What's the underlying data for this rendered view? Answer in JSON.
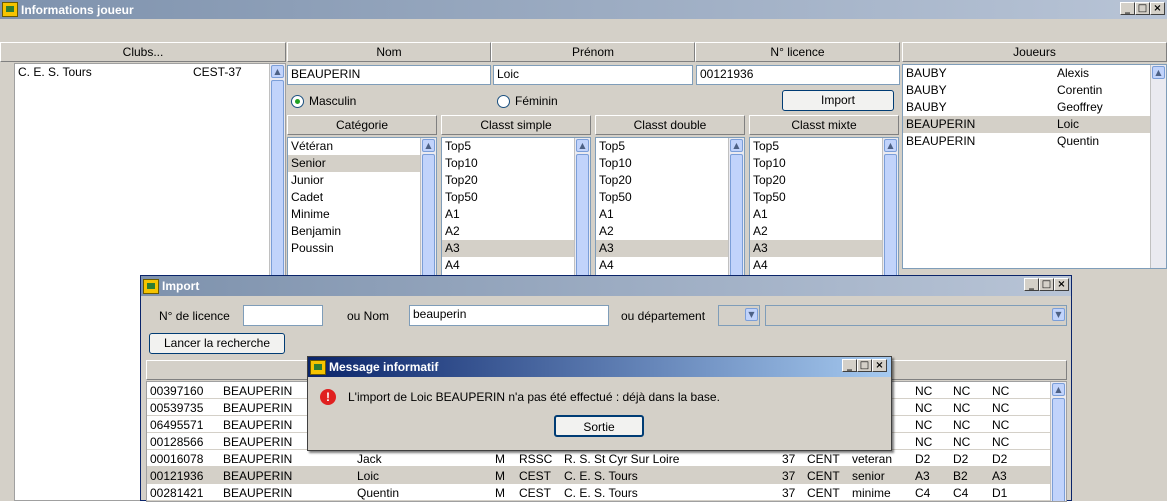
{
  "main_window": {
    "title": "Informations joueur",
    "clubs_button": "Clubs...",
    "headers": {
      "nom": "Nom",
      "prenom": "Prénom",
      "licence": "N° licence",
      "joueurs": "Joueurs"
    },
    "club_row": {
      "name": "C. E. S. Tours",
      "code": "CEST-37"
    },
    "player": {
      "nom": "BEAUPERIN",
      "prenom": "Loic",
      "licence": "00121936"
    },
    "gender": {
      "masculin": "Masculin",
      "feminin": "Féminin",
      "selected": "Masculin"
    },
    "import_button": "Import",
    "columns": {
      "categorie": "Catégorie",
      "simple": "Classt simple",
      "double": "Classt double",
      "mixte": "Classt mixte"
    },
    "categories": [
      {
        "label": "Vétéran",
        "selected": false
      },
      {
        "label": "Senior",
        "selected": true
      },
      {
        "label": "Junior",
        "selected": false
      },
      {
        "label": "Cadet",
        "selected": false
      },
      {
        "label": "Minime",
        "selected": false
      },
      {
        "label": "Benjamin",
        "selected": false
      },
      {
        "label": "Poussin",
        "selected": false
      }
    ],
    "classements": [
      "Top5",
      "Top10",
      "Top20",
      "Top50",
      "A1",
      "A2",
      "A3",
      "A4"
    ],
    "classement_selected": "A3",
    "joueurs": [
      {
        "nom": "BAUBY",
        "prenom": "Alexis",
        "selected": false
      },
      {
        "nom": "BAUBY",
        "prenom": "Corentin",
        "selected": false
      },
      {
        "nom": "BAUBY",
        "prenom": "Geoffrey",
        "selected": false
      },
      {
        "nom": "BEAUPERIN",
        "prenom": "Loic",
        "selected": true
      },
      {
        "nom": "BEAUPERIN",
        "prenom": "Quentin",
        "selected": false
      }
    ]
  },
  "import_window": {
    "title": "Import",
    "licence_label": "N° de licence",
    "licence_value": "",
    "nom_label": "ou Nom",
    "nom_value": "beauperin",
    "dept_label": "ou département",
    "search_button": "Lancer la recherche",
    "rows": [
      {
        "lic": "00397160",
        "nom": "BEAUPERIN",
        "prenom": "",
        "sexe": "",
        "code": "",
        "club": "",
        "dep": "",
        "ligue": "",
        "cat": "",
        "s": "NC",
        "d": "NC",
        "m": "NC",
        "selected": false
      },
      {
        "lic": "00539735",
        "nom": "BEAUPERIN",
        "prenom": "",
        "sexe": "",
        "code": "",
        "club": "",
        "dep": "",
        "ligue": "",
        "cat": "",
        "s": "NC",
        "d": "NC",
        "m": "NC",
        "selected": false
      },
      {
        "lic": "06495571",
        "nom": "BEAUPERIN",
        "prenom": "",
        "sexe": "",
        "code": "",
        "club": "",
        "dep": "",
        "ligue": "",
        "cat": "",
        "s": "NC",
        "d": "NC",
        "m": "NC",
        "selected": false
      },
      {
        "lic": "00128566",
        "nom": "BEAUPERIN",
        "prenom": "",
        "sexe": "",
        "code": "",
        "club": "",
        "dep": "",
        "ligue": "",
        "cat": "",
        "s": "NC",
        "d": "NC",
        "m": "NC",
        "selected": false
      },
      {
        "lic": "00016078",
        "nom": "BEAUPERIN",
        "prenom": "Jack",
        "sexe": "M",
        "code": "RSSC",
        "club": "R. S. St Cyr Sur Loire",
        "dep": "37",
        "ligue": "CENT",
        "cat": "veteran",
        "s": "D2",
        "d": "D2",
        "m": "D2",
        "selected": false
      },
      {
        "lic": "00121936",
        "nom": "BEAUPERIN",
        "prenom": "Loic",
        "sexe": "M",
        "code": "CEST",
        "club": "C. E. S. Tours",
        "dep": "37",
        "ligue": "CENT",
        "cat": "senior",
        "s": "A3",
        "d": "B2",
        "m": "A3",
        "selected": true
      },
      {
        "lic": "00281421",
        "nom": "BEAUPERIN",
        "prenom": "Quentin",
        "sexe": "M",
        "code": "CEST",
        "club": "C. E. S. Tours",
        "dep": "37",
        "ligue": "CENT",
        "cat": "minime",
        "s": "C4",
        "d": "C4",
        "m": "D1",
        "selected": false
      }
    ]
  },
  "message_dialog": {
    "title": "Message informatif",
    "text": "L'import de Loic BEAUPERIN n'a pas été effectué : déjà dans la base.",
    "button": "Sortie"
  }
}
